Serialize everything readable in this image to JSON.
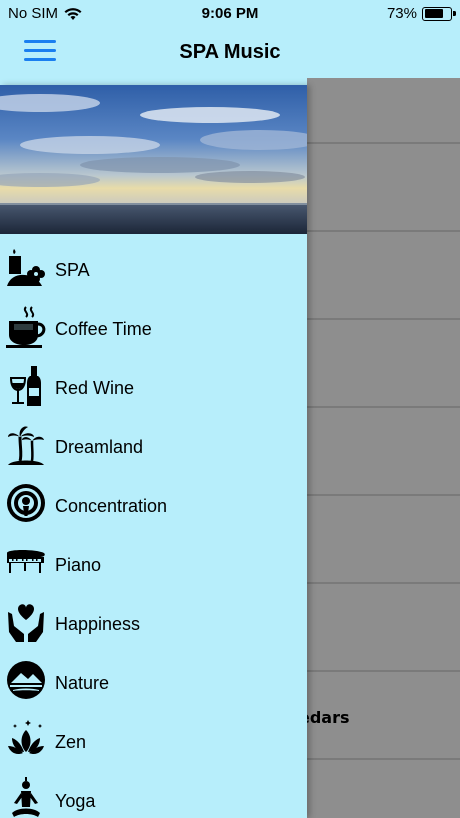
{
  "status": {
    "carrier": "No SIM",
    "time": "9:06 PM",
    "battery": "73%",
    "battery_level": 0.73
  },
  "nav": {
    "title": "SPA Music"
  },
  "drawer": {
    "items": [
      {
        "label": "SPA",
        "icon": "spa-candle-icon"
      },
      {
        "label": "Coffee Time",
        "icon": "coffee-cup-icon"
      },
      {
        "label": "Red Wine",
        "icon": "wine-icon"
      },
      {
        "label": "Dreamland",
        "icon": "palm-island-icon"
      },
      {
        "label": "Concentration",
        "icon": "concentration-icon"
      },
      {
        "label": "Piano",
        "icon": "piano-icon"
      },
      {
        "label": "Happiness",
        "icon": "heart-hands-icon"
      },
      {
        "label": "Nature",
        "icon": "mountain-icon"
      },
      {
        "label": "Zen",
        "icon": "lotus-icon"
      },
      {
        "label": "Yoga",
        "icon": "yoga-icon"
      }
    ]
  },
  "background_list": {
    "partial_label": "edars"
  }
}
